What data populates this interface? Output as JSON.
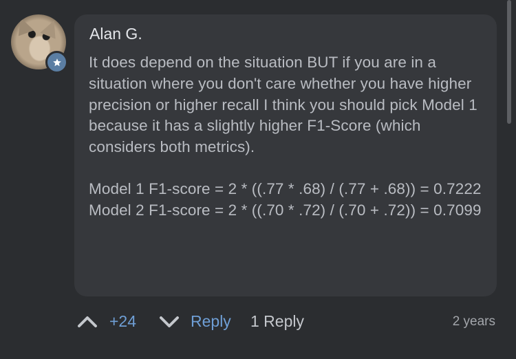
{
  "comment": {
    "author": "Alan G.",
    "paragraphs": [
      "It does depend on the situation BUT if you are in a situation where you don't care whether you have higher precision or higher recall I think you should pick Model 1 because it has a slightly higher F1-Score (which considers both metrics).",
      "Model 1 F1-score = 2 * ((.77 * .68) / (.77 + .68)) = 0.7222",
      "Model 2 F1-score = 2 * ((.70 * .72) / (.70 + .72)) = 0.7099"
    ],
    "avatar_icon": "cat-photo-avatar",
    "badge_icon": "star-icon"
  },
  "actions": {
    "upvote_icon": "chevron-up-icon",
    "score": "+24",
    "downvote_icon": "chevron-down-icon",
    "reply_label": "Reply",
    "reply_count_label": "1 Reply",
    "age": "2 years"
  },
  "colors": {
    "background": "#2b2d30",
    "bubble": "#36383c",
    "link": "#6f9fd6",
    "badge": "#5b7ea3"
  }
}
